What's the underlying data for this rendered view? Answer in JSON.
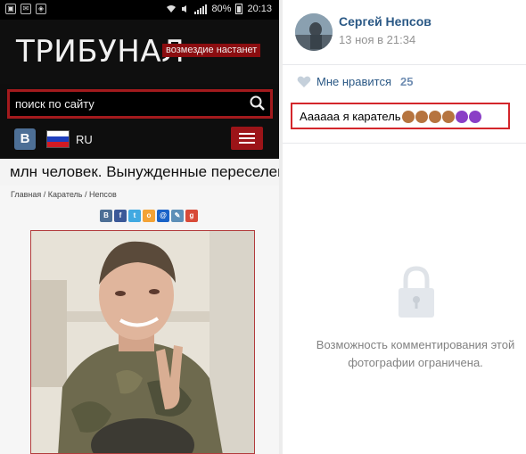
{
  "statusbar": {
    "battery": "80%",
    "time": "20:13"
  },
  "site": {
    "title": "ТРИБУНАЛ",
    "tagline": "возмездие настанет",
    "search_placeholder": "поиск по сайту",
    "vk_label": "В",
    "lang": "RU",
    "ticker": "млн человек. Вынужденные переселенцы",
    "breadcrumb": "Главная / Каратель / Непсов",
    "share_icons": [
      "vk-icon",
      "facebook-icon",
      "twitter-icon",
      "odnoklassniki-icon",
      "mailru-icon",
      "livejournal-icon",
      "googleplus-icon"
    ]
  },
  "vk_post": {
    "author": "Сергей Непсов",
    "date": "13 ноя в 21:34",
    "like_label": "Мне нравится",
    "like_count": "25",
    "caption_text": "Аааааа я каратель",
    "emojis": [
      "monkey-see-no-evil",
      "monkey-see-no-evil",
      "monkey-see-no-evil",
      "monkey-see-no-evil",
      "smiling-imp",
      "smiling-imp"
    ],
    "restricted_line1": "Возможность комментирования этой",
    "restricted_line2": "фотографии ограничена."
  },
  "colors": {
    "accent_red": "#a31a1d",
    "vk_blue": "#2a5885",
    "brand_dark": "#0f0f0f"
  }
}
